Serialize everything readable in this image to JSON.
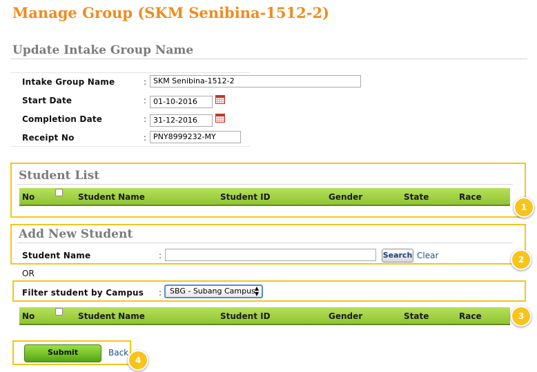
{
  "page": {
    "title": "Manage Group (SKM Senibina-1512-2)"
  },
  "update_section": {
    "title": "Update Intake Group Name",
    "fields": [
      {
        "label": "Intake Group Name",
        "value": "SKM Senibina-1512-2"
      },
      {
        "label": "Start Date",
        "value": "01-10-2016"
      },
      {
        "label": "Completion Date",
        "value": "31-12-2016"
      },
      {
        "label": "Receipt No",
        "value": "PNY8999232-MY"
      }
    ],
    "colon": ":"
  },
  "student_list": {
    "title": "Student List",
    "columns": [
      "No",
      "",
      "Student Name",
      "Student ID",
      "Gender",
      "State",
      "Race"
    ]
  },
  "add_student": {
    "title": "Add New Student",
    "name_label": "Student Name",
    "name_value": "",
    "search_label": "Search",
    "clear_label": "Clear",
    "or_text": "OR",
    "filter_label": "Filter student by Campus",
    "campus_selected": "SBG - Subang Campus",
    "columns": [
      "No",
      "",
      "Student Name",
      "Student ID",
      "Gender",
      "State",
      "Race"
    ]
  },
  "actions": {
    "submit_label": "Submit",
    "back_label": "Back"
  },
  "badges": [
    "1",
    "2",
    "3",
    "4"
  ],
  "colors": {
    "title": "#f28a1e",
    "highlight": "#f5c518",
    "header_bar": "#9ccf3c",
    "badge": "#f8c41b"
  }
}
